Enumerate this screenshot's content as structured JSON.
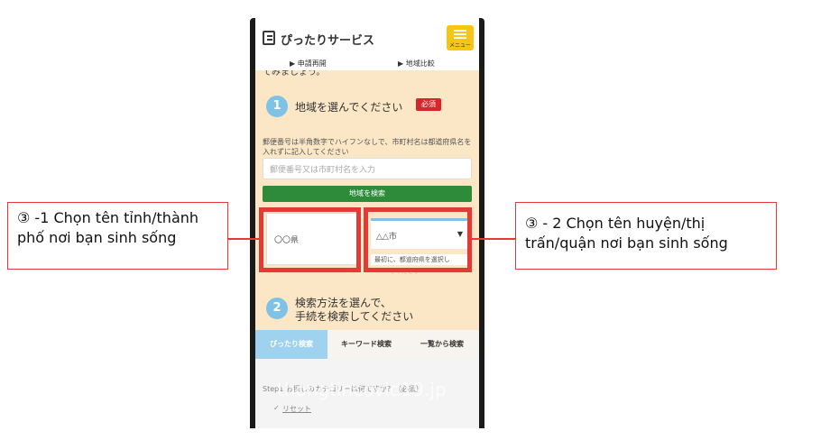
{
  "app": {
    "title": "ぴったりサービス",
    "menu_label": "メニュー"
  },
  "subnav": {
    "item1": "▶ 申請再開",
    "item2": "▶ 地域比較"
  },
  "cut_text": "てみましょう。",
  "section1": {
    "number": "1",
    "title": "地域を選んでください",
    "badge": "必須",
    "hint": "郵便番号は半角数字でハイフンなしで、市町村名は都道府県名を入れずに記入してください",
    "input_placeholder": "郵便番号又は市町村名を入力",
    "search_button": "地域を検索",
    "prefecture_value": "〇〇県",
    "city_value": "△△市",
    "city_note": "最初に、都道府県を選択し",
    "faded_text": "てください"
  },
  "section2": {
    "number": "2",
    "title_line1": "検索方法を選んで、",
    "title_line2": "手続を検索してください"
  },
  "tabs": [
    "ぴったり検索",
    "キーワード検索",
    "一覧から検索"
  ],
  "bottom": {
    "step_text": "Step1 お探しのカテゴリーは何ですか？（必須）",
    "reset": "リセット"
  },
  "watermark": "thongtincovid19.jp",
  "callouts": {
    "left": "③ -1 Chọn tên tỉnh/thành phố nơi bạn sinh sống",
    "right": "③ - 2 Chọn tên huyện/thị trấn/quận nơi bạn sinh sống"
  },
  "colors": {
    "highlight": "#e53935",
    "page_bg": "#fbe7c6",
    "green": "#2d8b3a",
    "accent": "#7ec3e6"
  }
}
